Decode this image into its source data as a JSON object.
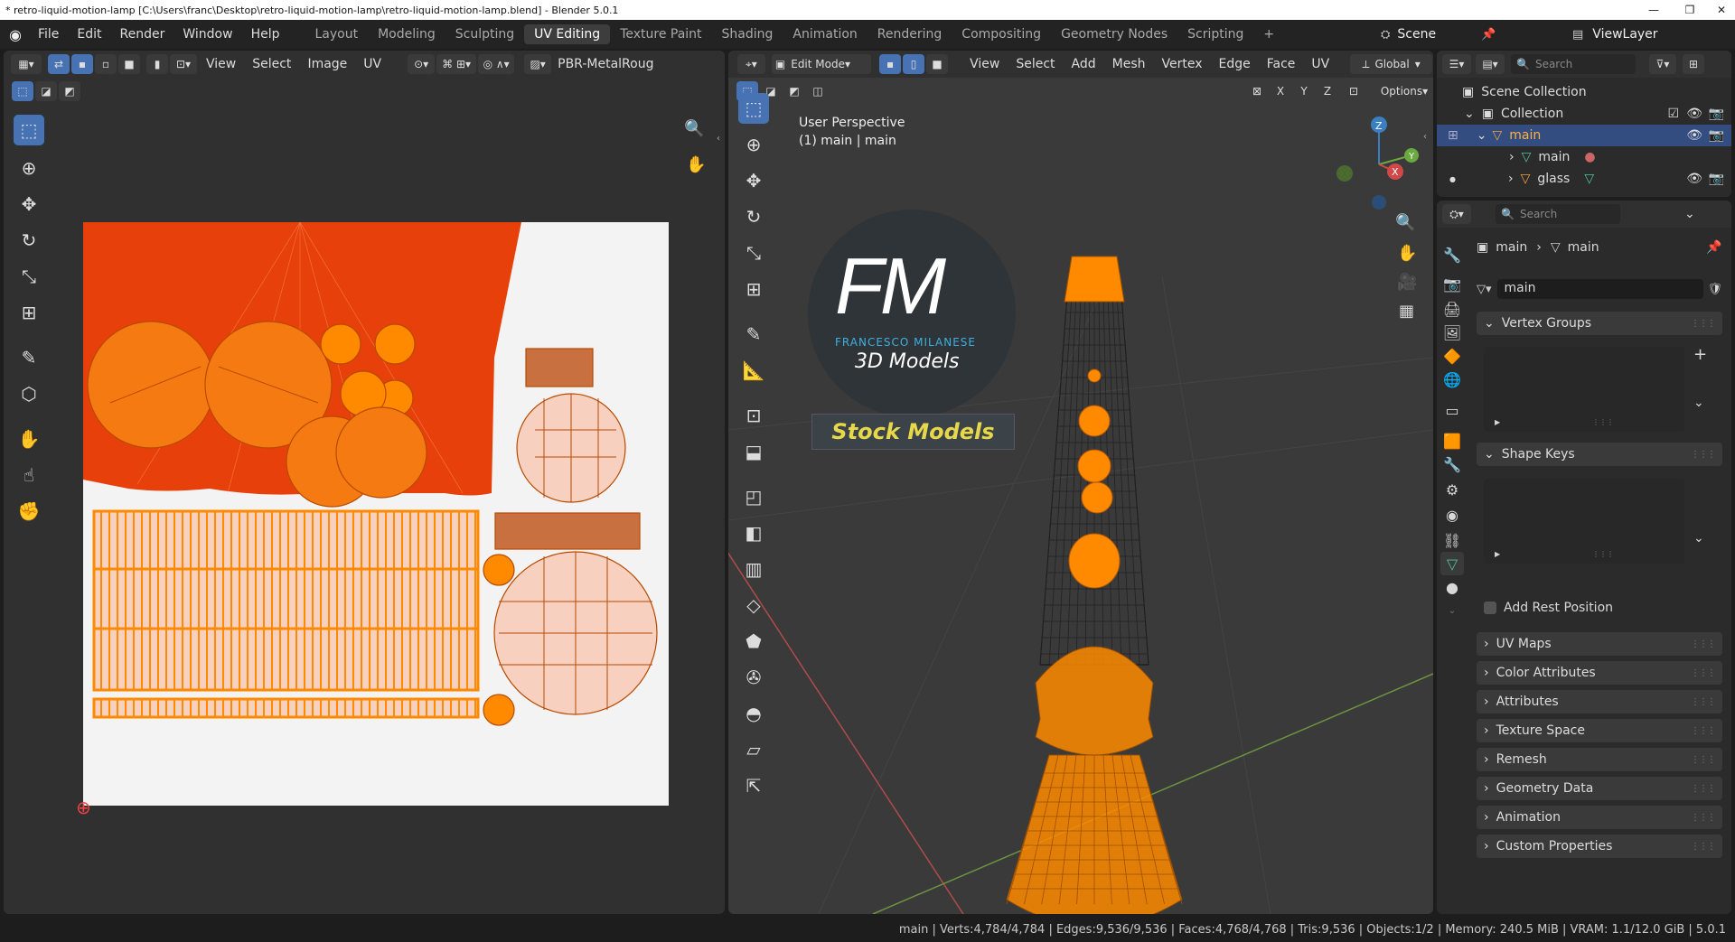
{
  "window": {
    "title": "* retro-liquid-motion-lamp [C:\\Users\\franc\\Desktop\\retro-liquid-motion-lamp\\retro-liquid-motion-lamp.blend] - Blender 5.0.1",
    "minimize": "—",
    "maximize": "❐",
    "close": "✕"
  },
  "topbar": {
    "menus": [
      "File",
      "Edit",
      "Render",
      "Window",
      "Help"
    ],
    "workspaces": [
      "Layout",
      "Modeling",
      "Sculpting",
      "UV Editing",
      "Texture Paint",
      "Shading",
      "Animation",
      "Rendering",
      "Compositing",
      "Geometry Nodes",
      "Scripting"
    ],
    "active_workspace": "UV Editing",
    "add_tab": "+",
    "scene": "Scene",
    "view_layer": "ViewLayer"
  },
  "uv_editor": {
    "menus": [
      "View",
      "Select",
      "Image",
      "UV"
    ],
    "image_name": "PBR-MetalRoug"
  },
  "viewport": {
    "mode": "Edit Mode",
    "menus": [
      "View",
      "Select",
      "Add",
      "Mesh",
      "Vertex",
      "Edge",
      "Face",
      "UV"
    ],
    "orientation": "Global",
    "axes": [
      "X",
      "Y",
      "Z"
    ],
    "options": "Options",
    "perspective": "User Perspective",
    "object_info": "(1) main | main",
    "gizmo": {
      "z": "Z",
      "y": "Y",
      "x": "X"
    },
    "watermark": {
      "letters": "FM",
      "name": "FRANCESCO MILANESE",
      "sub": "3D Models",
      "badge": "Stock Models"
    }
  },
  "outliner": {
    "search_placeholder": "Search",
    "scene_collection": "Scene Collection",
    "collection": "Collection",
    "items": [
      {
        "name": "main",
        "selected": true
      },
      {
        "name": "main",
        "type": "mesh-data"
      },
      {
        "name": "glass",
        "type": "object"
      }
    ]
  },
  "properties": {
    "search_placeholder": "Search",
    "breadcrumb": [
      "main",
      "main"
    ],
    "data_name": "main",
    "panels": [
      "Vertex Groups",
      "Shape Keys",
      "UV Maps",
      "Color Attributes",
      "Attributes",
      "Texture Space",
      "Remesh",
      "Geometry Data",
      "Animation",
      "Custom Properties"
    ],
    "add_rest_position": "Add Rest Position"
  },
  "statusbar": {
    "text": "main | Verts:4,784/4,784 | Edges:9,536/9,536 | Faces:4,768/4,768 | Tris:9,536 | Objects:1/2 | Memory: 240.5 MiB | VRAM: 1.1/12.0 GiB | 5.0.1"
  },
  "colors": {
    "accent": "#4772b3",
    "orange": "#ff8a00",
    "uv_red": "#e8400a"
  }
}
